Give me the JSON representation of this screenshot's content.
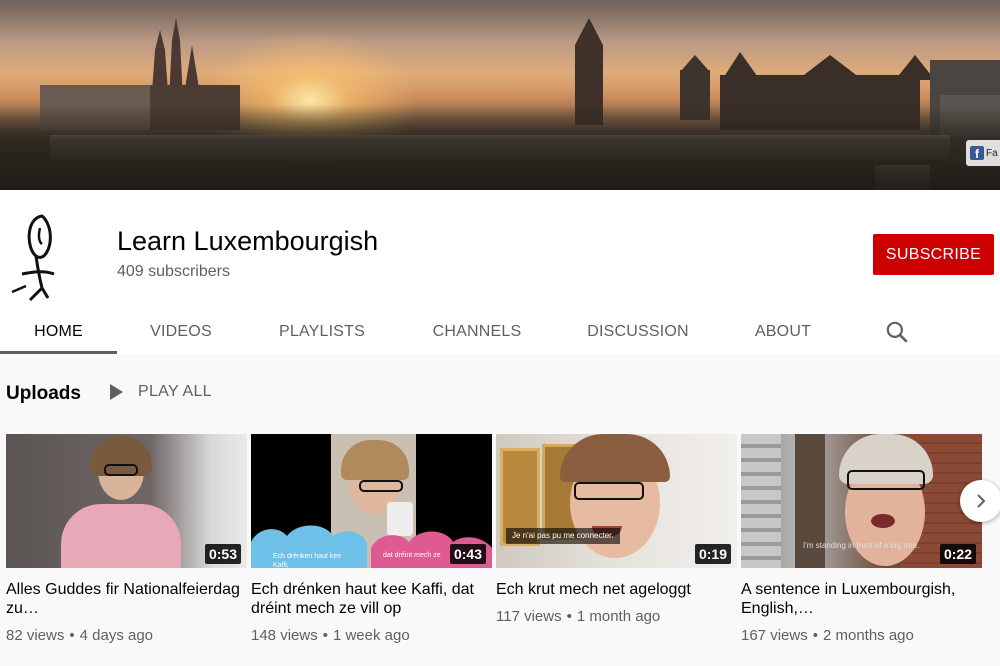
{
  "channel": {
    "name": "Learn Luxembourgish",
    "subscribers": "409 subscribers",
    "subscribe_label": "SUBSCRIBE",
    "avatar_icon": "stick-figure-avatar",
    "banner_link_text": "Fa"
  },
  "tabs": [
    {
      "label": "HOME",
      "active": true
    },
    {
      "label": "VIDEOS",
      "active": false
    },
    {
      "label": "PLAYLISTS",
      "active": false
    },
    {
      "label": "CHANNELS",
      "active": false
    },
    {
      "label": "DISCUSSION",
      "active": false
    },
    {
      "label": "ABOUT",
      "active": false
    }
  ],
  "search_icon": "search-icon",
  "uploads": {
    "title": "Uploads",
    "play_all_label": "PLAY ALL",
    "videos": [
      {
        "title": "Alles Guddes fir Nationalfeierdag zu…",
        "duration": "0:53",
        "views": "82 views",
        "age": "4 days ago"
      },
      {
        "title": "Ech drénken haut kee Kaffi, dat dréint mech ze vill op",
        "duration": "0:43",
        "views": "148 views",
        "age": "1 week ago",
        "caption_left": "Ech drénken haut kee Kaffi,",
        "caption_right": "dat dréint mech ze"
      },
      {
        "title": "Ech krut mech net ageloggt",
        "duration": "0:19",
        "views": "117 views",
        "age": "1 month ago",
        "caption": "Je n'ai pas pu me connecter."
      },
      {
        "title": "A sentence in Luxembourgish, English,…",
        "duration": "0:22",
        "views": "167 views",
        "age": "2 months ago",
        "caption": "I'm standing in front of a big tree."
      }
    ]
  },
  "colors": {
    "subscribe": "#cc0000",
    "tab_active_underline": "#606060",
    "meta_text": "#606060"
  }
}
